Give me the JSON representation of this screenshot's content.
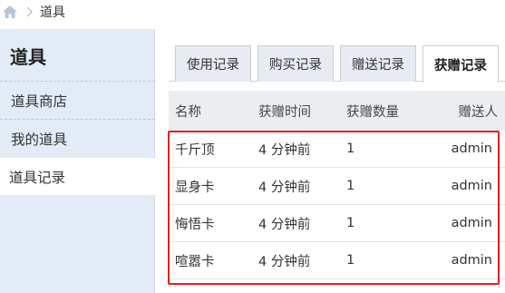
{
  "breadcrumb": {
    "home_icon": "home-icon",
    "separator_icon": "chevron-right-icon",
    "current": "道具"
  },
  "sidebar": {
    "title": "道具",
    "items": [
      {
        "label": "道具商店",
        "active": false
      },
      {
        "label": "我的道具",
        "active": false
      },
      {
        "label": "道具记录",
        "active": true
      }
    ]
  },
  "tabs": [
    {
      "label": "使用记录",
      "active": false
    },
    {
      "label": "购买记录",
      "active": false
    },
    {
      "label": "赠送记录",
      "active": false
    },
    {
      "label": "获赠记录",
      "active": true
    }
  ],
  "table": {
    "columns": [
      "名称",
      "获赠时间",
      "获赠数量",
      "赠送人"
    ],
    "rows": [
      {
        "name": "千斤顶",
        "time": "4 分钟前",
        "count": "1",
        "giver": "admin"
      },
      {
        "name": "显身卡",
        "time": "4 分钟前",
        "count": "1",
        "giver": "admin"
      },
      {
        "name": "悔悟卡",
        "time": "4 分钟前",
        "count": "1",
        "giver": "admin"
      },
      {
        "name": "喧嚣卡",
        "time": "4 分钟前",
        "count": "1",
        "giver": "admin"
      }
    ]
  },
  "colors": {
    "sidebar_bg": "#e3ecf6",
    "highlight": "#e02020",
    "tab_bg": "#e6ecf2",
    "header_bg": "#ebeef1"
  }
}
